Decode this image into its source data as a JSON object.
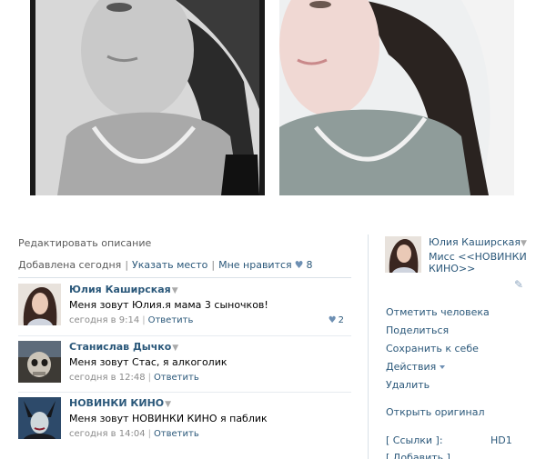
{
  "photo": {
    "left_alt": "black-and-white portrait",
    "right_alt": "color portrait"
  },
  "description": {
    "edit_label": "Редактировать описание"
  },
  "meta": {
    "added_label": "Добавлена сегодня",
    "location_label": "Указать место",
    "like_label": "Мне нравится",
    "like_count": "8",
    "separator": "|"
  },
  "comments": [
    {
      "author": "Юлия Каширская",
      "text": "Меня зовут Юлия.я мама 3 сыночков!",
      "time": "сегодня в 9:14",
      "reply_label": "Ответить",
      "likes": "2"
    },
    {
      "author": "Станислав Дычко",
      "text": "Меня зовут Стас, я алкоголик",
      "time": "сегодня в 12:48",
      "reply_label": "Ответить",
      "likes": ""
    },
    {
      "author": "НОВИНКИ КИНО",
      "text": "Меня зовут НОВИНКИ КИНО я паблик",
      "time": "сегодня в 14:04",
      "reply_label": "Ответить",
      "likes": ""
    }
  ],
  "sidebar": {
    "owner_name": "Юлия Каширская",
    "owner_description": "Мисс <<НОВИНКИ КИНО>>",
    "actions": {
      "tag_person": "Отметить человека",
      "share": "Поделиться",
      "save": "Сохранить к себе",
      "actions": "Действия",
      "delete": "Удалить",
      "open_original": "Открыть оригинал",
      "links": "[ Ссылки ]:",
      "add": "[ Добавить ]"
    },
    "hd_label": "HD1"
  },
  "colors": {
    "link": "#2b587a",
    "muted": "#8a8a8a",
    "divider": "#dae1e8"
  }
}
